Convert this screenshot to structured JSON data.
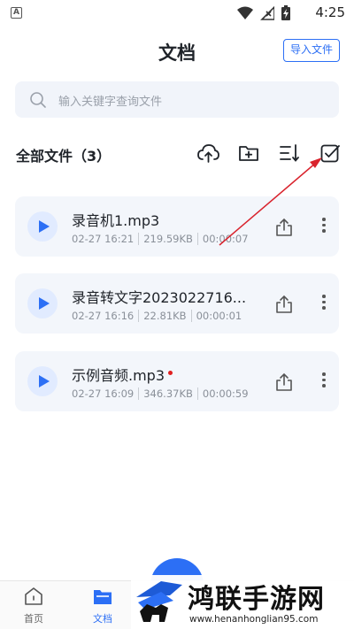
{
  "status_bar": {
    "notification_icon": "A",
    "time": "4:25",
    "icons": [
      "wifi-icon",
      "no-signal-icon",
      "battery-charging-icon"
    ]
  },
  "header": {
    "title": "文档",
    "import_label": "导入文件"
  },
  "search": {
    "placeholder": "输入关键字查询文件"
  },
  "list": {
    "title": "全部文件（3）",
    "tools": [
      "cloud-upload-icon",
      "new-folder-icon",
      "sort-icon",
      "multi-select-icon"
    ]
  },
  "files": [
    {
      "name": "录音机1.mp3",
      "date": "02-27 16:21",
      "size": "219.59KB",
      "duration": "00:00:07",
      "new": false
    },
    {
      "name": "录音转文字2023022716...",
      "date": "02-27 16:16",
      "size": "22.81KB",
      "duration": "00:00:01",
      "new": false
    },
    {
      "name": "示例音频.mp3",
      "date": "02-27 16:09",
      "size": "346.37KB",
      "duration": "00:00:59",
      "new": true
    }
  ],
  "bottom_nav": {
    "items": [
      {
        "label": "首页",
        "active": false
      },
      {
        "label": "文档",
        "active": true
      }
    ]
  },
  "watermark": {
    "text": "鸿联手游网",
    "url": "www.henanhonglian95.com"
  },
  "colors": {
    "accent": "#2c6ff5",
    "card_bg": "#f3f6fb",
    "annotation_arrow": "#d9232d",
    "new_dot": "#e02020"
  }
}
